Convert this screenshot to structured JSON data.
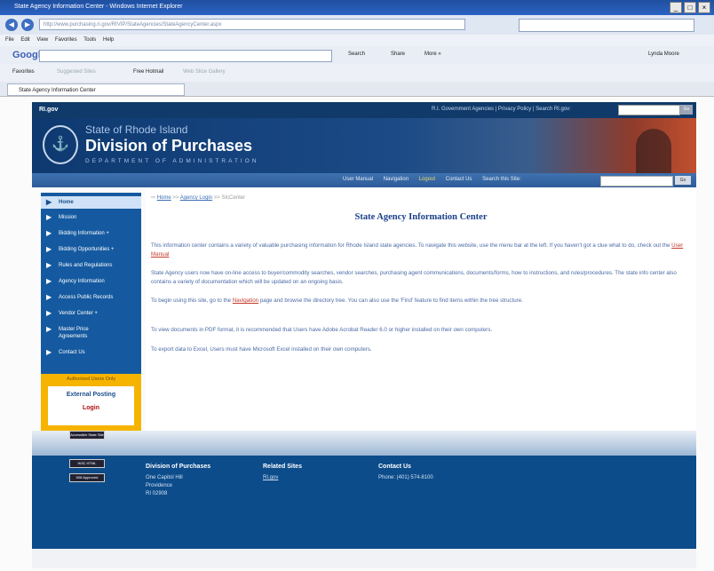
{
  "browser": {
    "window_title": "State Agency Information Center - Windows Internet Explorer",
    "address": "http://www.purchasing.ri.gov/RIVIP/StateAgencies/StateAgencyCenter.aspx",
    "menu": [
      "File",
      "Edit",
      "View",
      "Favorites",
      "Tools",
      "Help"
    ],
    "google_label": "Google",
    "google_tools": [
      "Search",
      "Share",
      "More »"
    ],
    "user": "Lynda Moore",
    "favorites_label": "Favorites",
    "favorites_items": [
      "Suggested Sites",
      "Free Hotmail",
      "Web Slice Gallery"
    ],
    "tab_title": "State Agency Information Center"
  },
  "site": {
    "logo": "RI.gov",
    "top_links": "R.I. Government Agencies  |  Privacy Policy  |  Search RI.gov:",
    "search_btn": "Go",
    "state_name": "State of Rhode Island",
    "division": "Division of Purchases",
    "department": "DEPARTMENT OF ADMINISTRATION",
    "subnav": [
      "User Manual",
      "Navigation",
      "Logout",
      "Contact Us",
      "Search this Site:"
    ],
    "subnav_btn": "Go"
  },
  "sidebar": {
    "items": [
      "Home",
      "Mission",
      "Bidding Information",
      "Bidding Opportunities",
      "Rules and Regulations",
      "Agency Information",
      "Access Public Records",
      "Vendor Center",
      "Master Price Agreements",
      "Contact Us"
    ],
    "auth_label": "Authorized Users Only",
    "external_posting": "External Posting",
    "login": "Login"
  },
  "content": {
    "breadcrumb_home": "Home",
    "breadcrumb_agency": "Agency Login",
    "breadcrumb_current": "SIcCenter",
    "title": "State Agency Information Center",
    "p1_a": "This information center contains a variety of valuable purchasing information for Rhode Island state agencies.  To navigate this website, use the menu bar at the left.  If you haven't got a clue what to do, check out the ",
    "p1_link": "User Manual",
    "p2": "State Agency users now have on-line access to buyer/commodity searches, vendor searches, purchasing agent communications, documents/forms, how to instructions, and rules/procedures. The state info center also contains a variety of documentation which will be updated on an ongoing basis.",
    "p3_a": "To begin using this site, go to the ",
    "p3_link": "Navigation",
    "p3_b": " page and browse the directory tree.  You can also use the 'Find' feature to find items within the tree structure.",
    "p4": "To view documents in PDF format, it is recommended that Users have Adobe Acrobat Reader 6.0 or higher installed on their own computers.",
    "p5": "To export data to Excel, Users must have Microsoft Excel installed on their own computers."
  },
  "footer": {
    "col1_title": "Division of Purchases",
    "col1_lines": [
      "One Capitol Hill",
      "Providence",
      "RI 02908"
    ],
    "col2_title": "Related Sites",
    "col2_link": "RI.gov",
    "col3_title": "Contact Us",
    "col3_phone": "Phone: (401) 574-8100",
    "badges": [
      "Accessible State Site",
      "W3C HTML",
      "508 Approved"
    ]
  }
}
